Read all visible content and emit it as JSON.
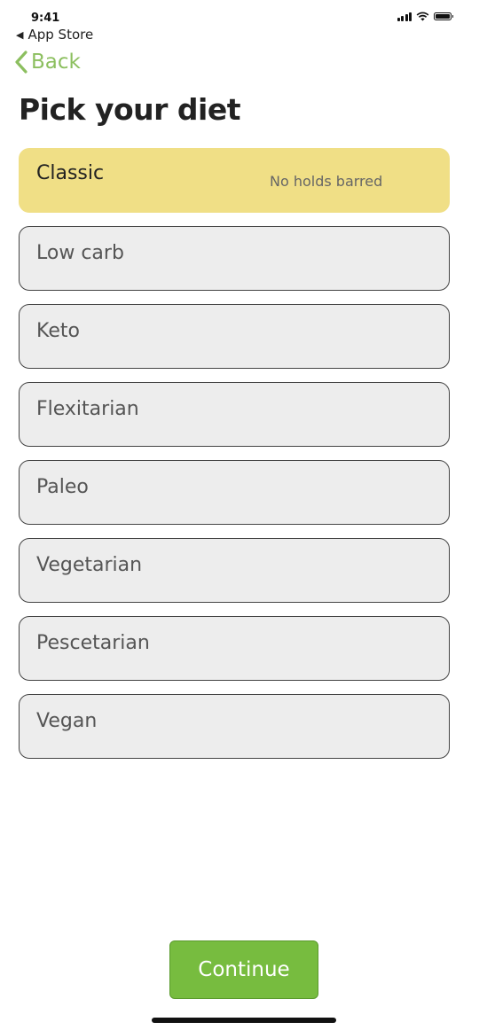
{
  "status": {
    "time": "9:41",
    "icons": [
      "cellular-signal-icon",
      "wifi-icon",
      "battery-icon"
    ]
  },
  "nav": {
    "app_store_label": "App Store",
    "back_label": "Back"
  },
  "page": {
    "title": "Pick your diet"
  },
  "diets": [
    {
      "label": "Classic",
      "description": "No holds barred",
      "selected": true
    },
    {
      "label": "Low carb",
      "description": "",
      "selected": false
    },
    {
      "label": "Keto",
      "description": "",
      "selected": false
    },
    {
      "label": "Flexitarian",
      "description": "",
      "selected": false
    },
    {
      "label": "Paleo",
      "description": "",
      "selected": false
    },
    {
      "label": "Vegetarian",
      "description": "",
      "selected": false
    },
    {
      "label": "Pescetarian",
      "description": "",
      "selected": false
    },
    {
      "label": "Vegan",
      "description": "",
      "selected": false
    }
  ],
  "footer": {
    "continue_label": "Continue"
  },
  "colors": {
    "accent_green": "#77bc3f",
    "back_link_green": "#8cbf5f",
    "selected_option": "#f0df86",
    "option_background": "#ededed"
  }
}
